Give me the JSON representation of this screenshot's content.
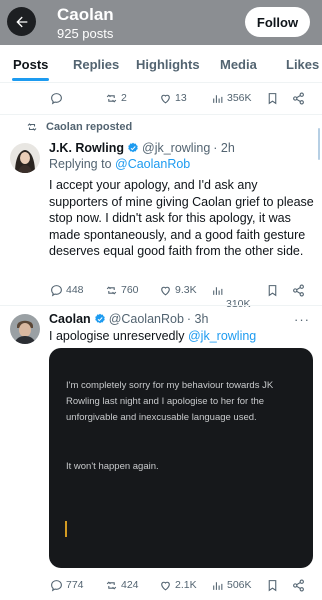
{
  "header": {
    "name": "Caolan",
    "post_count": "925 posts",
    "follow_label": "Follow"
  },
  "tabs": [
    {
      "label": "Posts",
      "active": true
    },
    {
      "label": "Replies",
      "active": false
    },
    {
      "label": "Highlights",
      "active": false
    },
    {
      "label": "Media",
      "active": false
    },
    {
      "label": "Likes",
      "active": false
    }
  ],
  "prev_post": {
    "replies": "",
    "reposts": "2",
    "likes": "13",
    "views": "356K"
  },
  "repost_banner": "Caolan reposted",
  "rowling_post": {
    "name": "J.K. Rowling",
    "handle": "@jk_rowling",
    "time": "· 2h",
    "replying_prefix": "Replying to ",
    "replying_to": "@CaolanRob",
    "text": "I accept your apology, and I'd ask any supporters of mine giving Caolan grief to please stop now. I didn't ask for this apology, it was made spontaneously, and a good faith gesture deserves equal good faith from the other side.",
    "replies": "448",
    "reposts": "760",
    "likes": "9.3K",
    "views": "310K"
  },
  "caolan_post": {
    "name": "Caolan",
    "handle": "@CaolanRob",
    "time": "· 3h",
    "text_prefix": "I apologise unreservedly ",
    "text_mention": "@jk_rowling",
    "media_text_1": "I'm completely sorry for my behaviour towards JK Rowling last night and I apologise to her for the unforgivable and inexcusable language used.",
    "media_text_2": "It won't happen again.",
    "replies": "774",
    "reposts": "424",
    "likes": "2.1K",
    "views": "506K"
  },
  "colors": {
    "accent": "#1d9bf0",
    "header_bg": "#8b8e92",
    "muted": "#536471"
  }
}
